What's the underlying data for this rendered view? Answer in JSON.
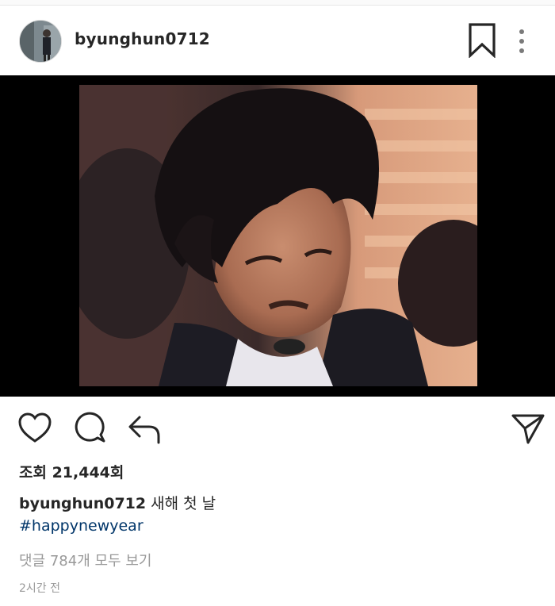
{
  "post": {
    "username": "byunghun0712",
    "views_label": "조회 21,444회",
    "caption_user": "byunghun0712",
    "caption_text": "새해 첫 날",
    "hashtag": "#happynewyear",
    "comments_link": "댓글 784개 모두 보기",
    "timestamp": "2시간 전"
  },
  "icons": {
    "bookmark": "bookmark-icon",
    "more": "more-vertical-icon",
    "like": "heart-icon",
    "comment": "comment-bubble-icon",
    "share": "reply-arrow-icon",
    "direct": "paper-plane-icon"
  },
  "colors": {
    "text": "#262626",
    "hashtag": "#003569",
    "muted": "#999999",
    "media_bg": "#000000"
  }
}
